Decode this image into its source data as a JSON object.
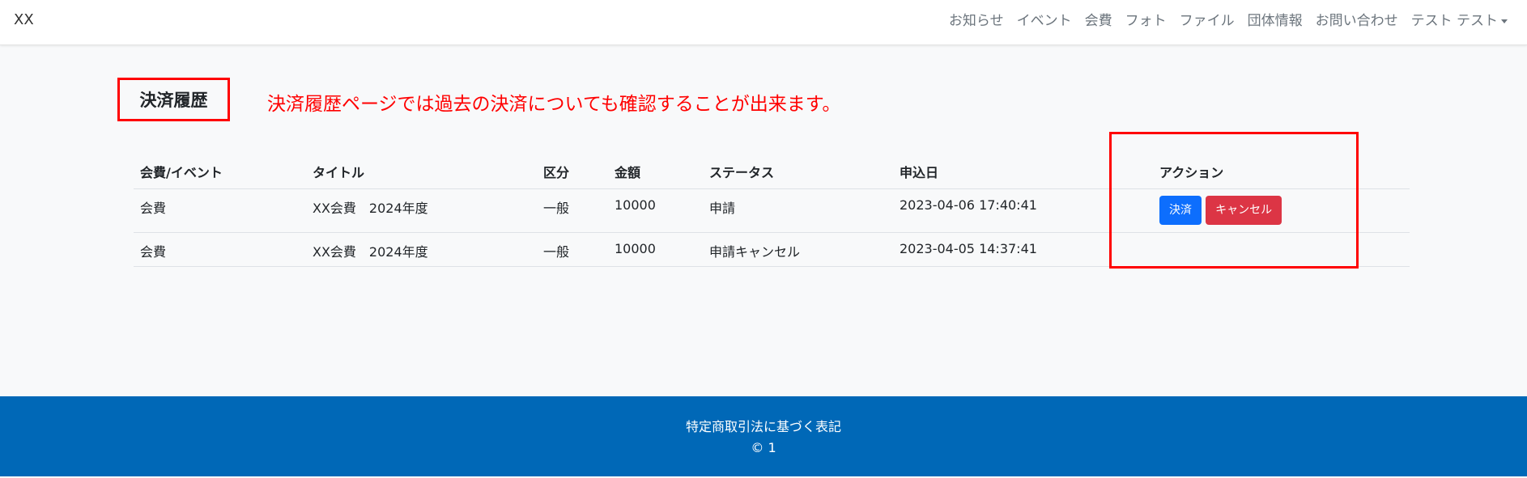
{
  "navbar": {
    "brand": "XX",
    "links": [
      "お知らせ",
      "イベント",
      "会費",
      "フォト",
      "ファイル",
      "団体情報",
      "お問い合わせ",
      "テスト テスト"
    ]
  },
  "page": {
    "title": "決済履歴",
    "note": "決済履歴ページでは過去の決済についても確認することが出来ます。"
  },
  "table": {
    "headers": [
      "会費/イベント",
      "タイトル",
      "区分",
      "金額",
      "ステータス",
      "申込日",
      "アクション"
    ],
    "rows": [
      [
        "会費",
        "XX会費　2024年度",
        "一般",
        "10000",
        "申請",
        "2023-04-06 17:40:41"
      ],
      [
        "会費",
        "XX会費　2024年度",
        "一般",
        "10000",
        "申請キャンセル",
        "2023-04-05 14:37:41"
      ]
    ],
    "actions": {
      "pay_label": "決済",
      "cancel_label": "キャンセル"
    }
  },
  "footer": {
    "link": "特定商取引法に基づく表記",
    "copyright": "© 1"
  },
  "colors": {
    "highlight": "#ff0000",
    "footer_bg": "#0068b7",
    "primary": "#0d6efd",
    "danger": "#dc3545"
  }
}
